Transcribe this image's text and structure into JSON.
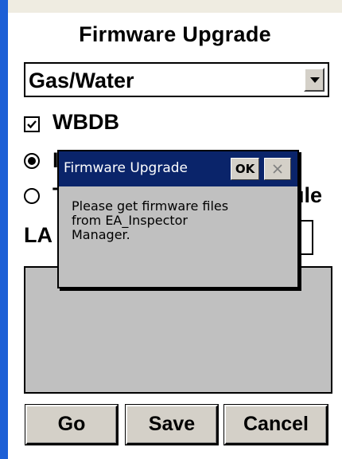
{
  "page": {
    "title": "Firmware Upgrade"
  },
  "device_select": {
    "value": "Gas/Water"
  },
  "wbdb_checkbox": {
    "label": "WBDB",
    "checked": true
  },
  "radio_options": [
    {
      "label": "I",
      "selected": true
    },
    {
      "label": "T",
      "suffix": "ule",
      "selected": false
    }
  ],
  "field": {
    "label": "LA"
  },
  "buttons": {
    "go": "Go",
    "save": "Save",
    "cancel": "Cancel"
  },
  "dialog": {
    "title": "Firmware Upgrade",
    "ok_label": "OK",
    "message_lines": [
      "Please get firmware files",
      "from EA_Inspector",
      "Manager."
    ]
  },
  "colors": {
    "left_edge": "#1c5fd6",
    "dialog_titlebar": "#0a246a",
    "panel_gray": "#c0c0c0",
    "button_face": "#d4d0c8"
  }
}
